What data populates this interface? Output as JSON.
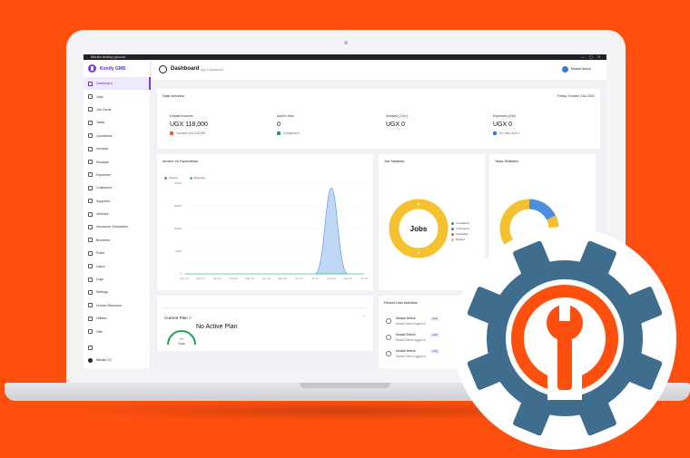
{
  "window": {
    "title": "Mkulla testing ground",
    "controls": [
      "—",
      "▢",
      "✕"
    ]
  },
  "sidebar": {
    "brand": "Konify GMS",
    "items": [
      {
        "label": "Dashboard",
        "active": true
      },
      {
        "label": "Jobs"
      },
      {
        "label": "Job Cards"
      },
      {
        "label": "Tasks"
      },
      {
        "label": "Quotations"
      },
      {
        "label": "Invoices"
      },
      {
        "label": "Receipts"
      },
      {
        "label": "Expenses"
      },
      {
        "label": "Customers"
      },
      {
        "label": "Suppliers"
      },
      {
        "label": "Vehicles"
      },
      {
        "label": "Insurance Companies"
      },
      {
        "label": "Branches"
      },
      {
        "label": "Roles"
      },
      {
        "label": "Users"
      },
      {
        "label": "Logs"
      },
      {
        "label": "Settings"
      },
      {
        "label": "Human Resource"
      },
      {
        "label": "Utilities"
      },
      {
        "label": "Otte"
      }
    ],
    "footer_user": "Mkulla CO"
  },
  "header": {
    "title": "Dashboard",
    "subtitle": "App Dashboard",
    "user": "Mudali Derick"
  },
  "overview": {
    "title": "Data overview",
    "date": "Friday, October 21st 2022",
    "columns": [
      {
        "label": "Unpaid Invoices",
        "value": "UGX 118,000",
        "foot": "Overdue UGX 118,000",
        "color": "#e85d2a"
      },
      {
        "label": "Active Jobs",
        "value": "0",
        "foot": "Completed 0",
        "color": "#22a35a"
      },
      {
        "label": "Invoices [ Oct ]",
        "value": "UGX 0",
        "foot": "",
        "color": "#888888"
      },
      {
        "label": "Expenses (Oct)",
        "value": "UGX 0",
        "foot": "On Jobs UGX 0",
        "color": "#2a7de1"
      }
    ]
  },
  "income_chart": {
    "title": "Income Vs Expenditure",
    "legend": [
      {
        "name": "Income",
        "color": "#4a90e2"
      },
      {
        "name": "Expense",
        "color": "#3cc98b"
      }
    ]
  },
  "chart_data": {
    "type": "area",
    "title": "Income Vs Expenditure",
    "categories": [
      "Nov 21",
      "Dec 21",
      "Jan 22",
      "Feb 22",
      "Mar 22",
      "Apr 22",
      "May 22",
      "Jun 22",
      "Jul 22",
      "Aug 22",
      "Sep 22",
      "Oct 22"
    ],
    "yticks": [
      "20000",
      "15000",
      "10000",
      "5000",
      "0"
    ],
    "ylim": [
      0,
      20000
    ],
    "series": [
      {
        "name": "Income",
        "values": [
          0,
          0,
          0,
          0,
          0,
          0,
          0,
          0,
          0,
          19000,
          0,
          0
        ]
      },
      {
        "name": "Expense",
        "values": [
          0,
          0,
          0,
          0,
          0,
          0,
          0,
          0,
          0,
          0,
          0,
          0
        ]
      }
    ]
  },
  "jobs_stats": {
    "title": "Job Statistics",
    "center_label": "Jobs",
    "legend": [
      {
        "name": "Completed",
        "color": "#22a35a"
      },
      {
        "name": "In Progress",
        "color": "#2a7de1"
      },
      {
        "name": "Cancelled",
        "color": "#e85d2a"
      },
      {
        "name": "Drafted",
        "color": "#f5c12e"
      }
    ]
  },
  "tasks_stats": {
    "title": "Tasks Statistics"
  },
  "current_plan": {
    "title": "Current Plan",
    "chevron": ">",
    "status": "No Active Plan",
    "gauge_value": "0.0",
    "gauge_unit": "Days"
  },
  "activities": {
    "title": "Recent User Activities",
    "items": [
      {
        "name": "Mudali Derick",
        "badge": "Auth",
        "desc": "Mudali Derick logged in"
      },
      {
        "name": "Mudali Derick",
        "badge": "Auth",
        "desc": "Mudali Derick logged in"
      },
      {
        "name": "Mudali Derick",
        "badge": "Auth",
        "desc": "Mudali Derick logged in"
      }
    ]
  },
  "colors": {
    "background": "#ff4f0f",
    "accent": "#7c3aed",
    "gear": "#3f6d8e",
    "logo": "#ff4f0f"
  }
}
